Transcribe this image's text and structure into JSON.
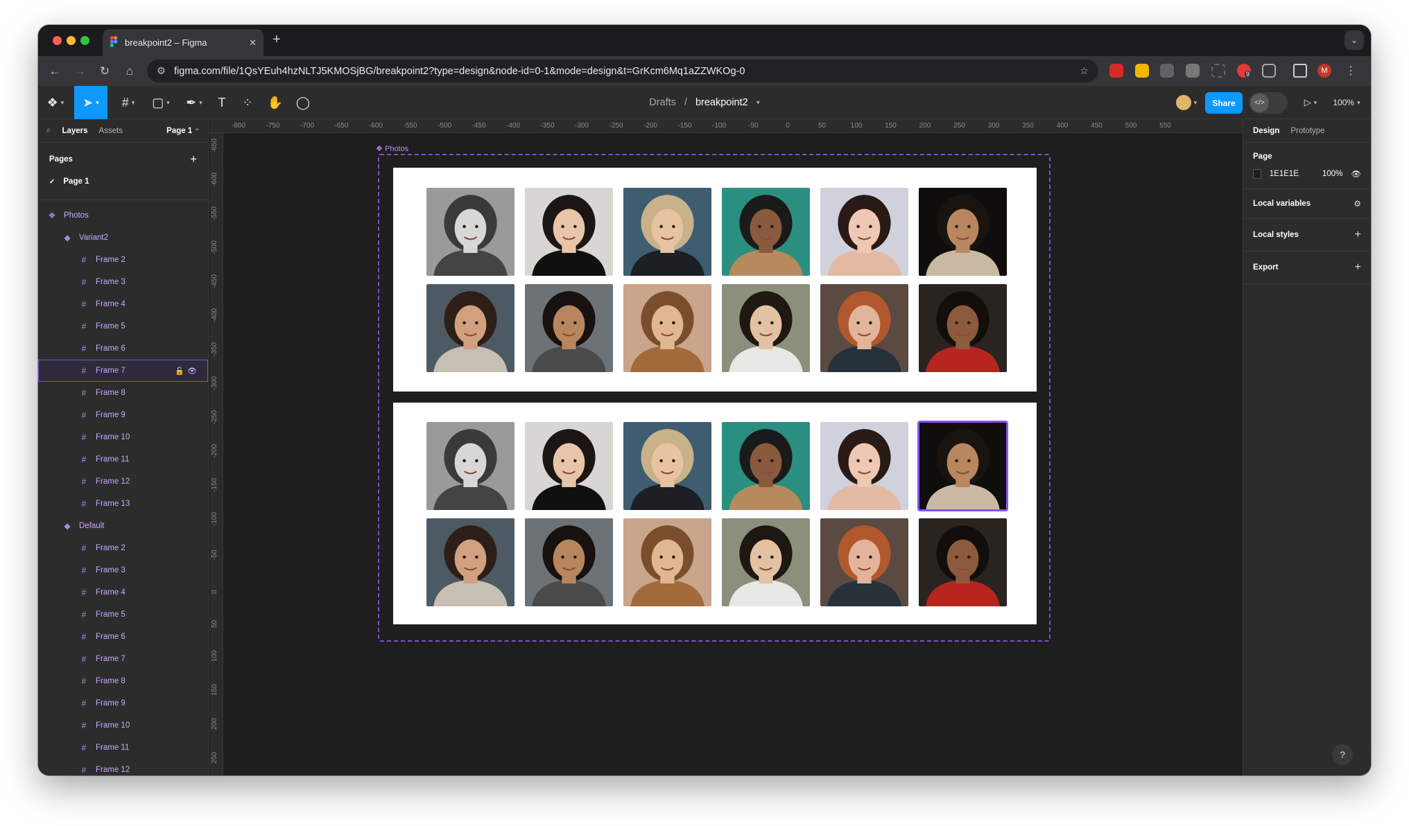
{
  "browser": {
    "tab_title": "breakpoint2 – Figma",
    "url": "figma.com/file/1QsYEuh4hzNLTJ5KMOSjBG/breakpoint2?type=design&node-id=0-1&mode=design&t=GrKcm6Mq1aZZWKOg-0",
    "profile_initial": "M",
    "ext_badge": "9"
  },
  "toolbar": {
    "drafts": "Drafts",
    "sep": "/",
    "file_name": "breakpoint2",
    "share": "Share",
    "zoom": "100%"
  },
  "left_panel": {
    "tabs": [
      "Layers",
      "Assets"
    ],
    "page_selector": "Page 1",
    "pages_title": "Pages",
    "pages": [
      "Page 1"
    ],
    "root": "Photos",
    "groups": [
      {
        "name": "Variant2",
        "frames": [
          "Frame 2",
          "Frame 3",
          "Frame 4",
          "Frame 5",
          "Frame 6",
          "Frame 7",
          "Frame 8",
          "Frame 9",
          "Frame 10",
          "Frame 11",
          "Frame 12",
          "Frame 13"
        ],
        "selected": "Frame 7"
      },
      {
        "name": "Default",
        "frames": [
          "Frame 2",
          "Frame 3",
          "Frame 4",
          "Frame 5",
          "Frame 6",
          "Frame 7",
          "Frame 8",
          "Frame 9",
          "Frame 10",
          "Frame 11",
          "Frame 12"
        ]
      }
    ]
  },
  "rulers": {
    "top": [
      "-800",
      "-750",
      "-700",
      "-650",
      "-600",
      "-550",
      "-500",
      "-450",
      "-400",
      "-350",
      "-300",
      "-250",
      "-200",
      "-150",
      "-100",
      "-50",
      "0",
      "50",
      "100",
      "150",
      "200",
      "250",
      "300",
      "350",
      "400",
      "450",
      "500",
      "550"
    ],
    "left": [
      "-650",
      "-600",
      "-550",
      "-500",
      "-450",
      "-400",
      "-350",
      "-300",
      "-250",
      "-200",
      "-150",
      "-100",
      "-50",
      "0",
      "50",
      "100",
      "150",
      "200",
      "250"
    ]
  },
  "canvas": {
    "frame_label": "Photos",
    "highlighted_photo": "card 2, photo 6"
  },
  "right_panel": {
    "tabs": [
      "Design",
      "Prototype"
    ],
    "page_title": "Page",
    "bg_hex": "1E1E1E",
    "bg_opacity": "100%",
    "local_variables": "Local variables",
    "local_styles": "Local styles",
    "export": "Export"
  },
  "colors": {
    "accent": "#0d99ff",
    "component": "#9747ff",
    "canvas": "#1e1e1e"
  },
  "photos": [
    {
      "bg": "#9a9a9a",
      "skin": "#d7d7d7",
      "hair": "#3a3a3a",
      "shirt": "#444444"
    },
    {
      "bg": "#d8d6d2",
      "skin": "#e8c5a8",
      "hair": "#1b1513",
      "shirt": "#101010"
    },
    {
      "bg": "#3f5d70",
      "skin": "#e7c3a2",
      "hair": "#c9b18a",
      "shirt": "#1c1f23"
    },
    {
      "bg": "#2a8f80",
      "skin": "#8a5a3e",
      "hair": "#1a1a1a",
      "shirt": "#b58a5d"
    },
    {
      "bg": "#cfd2dc",
      "skin": "#eec7b5",
      "hair": "#2a1a15",
      "shirt": "#e3b9a4"
    },
    {
      "bg": "#0f0e0d",
      "skin": "#b8865f",
      "hair": "#1a1410",
      "shirt": "#c9b9a2"
    },
    {
      "bg": "#4e5a63",
      "skin": "#d1a07f",
      "hair": "#2d1f18",
      "shirt": "#c7bfb2"
    },
    {
      "bg": "#6c7276",
      "skin": "#b7865e",
      "hair": "#17120f",
      "shirt": "#4a4a4a"
    },
    {
      "bg": "#c9a58b",
      "skin": "#e1b793",
      "hair": "#7a4e2c",
      "shirt": "#a36a3c"
    },
    {
      "bg": "#8b8f7c",
      "skin": "#e3c1a3",
      "hair": "#1f1812",
      "shirt": "#e8e8e6"
    },
    {
      "bg": "#5a4a42",
      "skin": "#e2b49a",
      "hair": "#b1582e",
      "shirt": "#27313a"
    },
    {
      "bg": "#2a2420",
      "skin": "#8c5a3c",
      "hair": "#120e0b",
      "shirt": "#b7251f"
    }
  ]
}
